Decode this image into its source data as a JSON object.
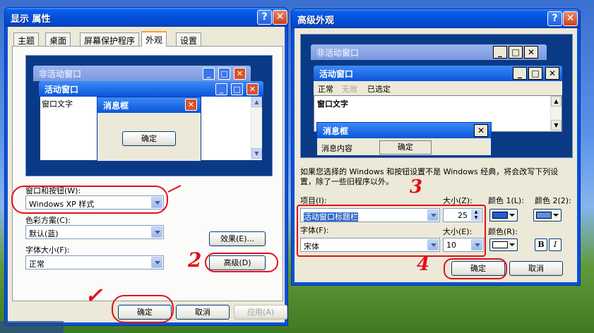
{
  "left_window": {
    "title": "显示 属性",
    "help_label": "?",
    "close_label": "✕",
    "tabs": [
      "主题",
      "桌面",
      "屏幕保护程序",
      "外观",
      "设置"
    ],
    "preview": {
      "inactive_title": "非活动窗口",
      "active_title": "活动窗口",
      "window_text": "窗口文字",
      "msgbox_title": "消息框",
      "msgbox_ok": "确定"
    },
    "windows_buttons_label": "窗口和按钮(W):",
    "windows_buttons_value": "Windows XP 样式",
    "color_scheme_label": "色彩方案(C):",
    "color_scheme_value": "默认(蓝)",
    "font_size_label": "字体大小(F):",
    "font_size_value": "正常",
    "effects_button": "效果(E)...",
    "advanced_button": "高级(D)",
    "ok_button": "确定",
    "cancel_button": "取消",
    "apply_button": "应用(A)"
  },
  "right_window": {
    "title": "高级外观",
    "help_label": "?",
    "close_label": "✕",
    "preview": {
      "inactive_title": "非活动窗口",
      "active_title": "活动窗口",
      "menu_items": [
        "正常",
        "无效",
        "已选定"
      ],
      "window_text": "窗口文字",
      "msgbox_title": "消息框",
      "msgbox_text": "消息内容",
      "msgbox_ok": "确定"
    },
    "description": "如果您选择的 Windows 和按钮设置不是 Windows 经典，将会改写下列设置，除了一些旧程序以外。",
    "item_label": "项目(I):",
    "item_value": "活动窗口标题栏",
    "size_label": "大小(Z):",
    "size_value": "25",
    "color1_label": "颜色 1(L):",
    "color2_label": "颜色 2(2):",
    "color1_value": "#1f5fd6",
    "color2_value": "#5a8ee8",
    "font_label": "字体(F):",
    "font_value": "宋体",
    "font_size_label": "大小(E):",
    "font_size_value": "10",
    "font_color_label": "颜色(R):",
    "font_color_value": "#ffffff",
    "bold_label": "B",
    "italic_label": "I",
    "ok_button": "确定",
    "cancel_button": "取消"
  },
  "annotations": {
    "mark_2": "2",
    "mark_3": "3",
    "mark_4": "4",
    "mark_check": "✓"
  },
  "colors": {
    "xp_blue": "#0a52d8",
    "annotation_red": "#e0101a",
    "dialog_bg": "#ece9d8"
  }
}
